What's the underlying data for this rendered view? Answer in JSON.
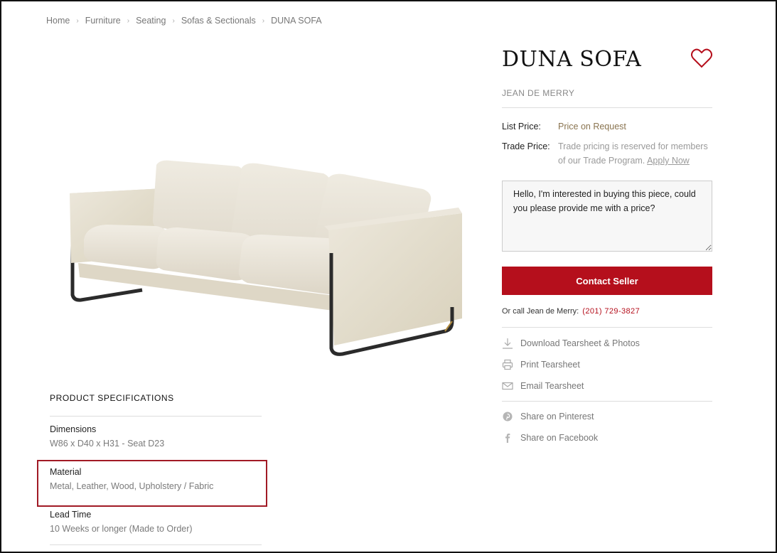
{
  "breadcrumb": {
    "items": [
      {
        "label": "Home"
      },
      {
        "label": "Furniture"
      },
      {
        "label": "Seating"
      },
      {
        "label": "Sofas & Sectionals"
      },
      {
        "label": "DUNA SOFA"
      }
    ],
    "separator": "›"
  },
  "product": {
    "title": "DUNA SOFA",
    "brand": "JEAN DE MERRY",
    "image_alt": "sofa-image"
  },
  "pricing": {
    "list_label": "List Price:",
    "list_value": "Price on Request",
    "trade_label": "Trade Price:",
    "trade_text": "Trade pricing is reserved for members of our Trade Program.",
    "trade_link": "Apply Now"
  },
  "contact": {
    "message": "Hello, I'm interested in buying this piece, could you please provide me with a price?",
    "button_label": "Contact Seller",
    "call_text": "Or call Jean de Merry:",
    "phone": "(201) 729-3827"
  },
  "actions": [
    {
      "label": "Download Tearsheet & Photos",
      "icon": "download-icon"
    },
    {
      "label": "Print Tearsheet",
      "icon": "printer-icon"
    },
    {
      "label": "Email Tearsheet",
      "icon": "envelope-icon"
    }
  ],
  "social": [
    {
      "label": "Share on Pinterest",
      "icon": "pinterest-icon"
    },
    {
      "label": "Share on Facebook",
      "icon": "facebook-icon"
    }
  ],
  "specs": {
    "title": "PRODUCT SPECIFICATIONS",
    "items": [
      {
        "label": "Dimensions",
        "value": "W86 x D40 x H31 - Seat D23"
      },
      {
        "label": "Material",
        "value": "Metal, Leather, Wood, Upholstery / Fabric"
      },
      {
        "label": "Lead Time",
        "value": "10 Weeks or longer  (Made to Order)"
      }
    ]
  },
  "colors": {
    "accent": "#b50f1c",
    "price": "#8a7450",
    "highlight_border": "#a11a25"
  }
}
